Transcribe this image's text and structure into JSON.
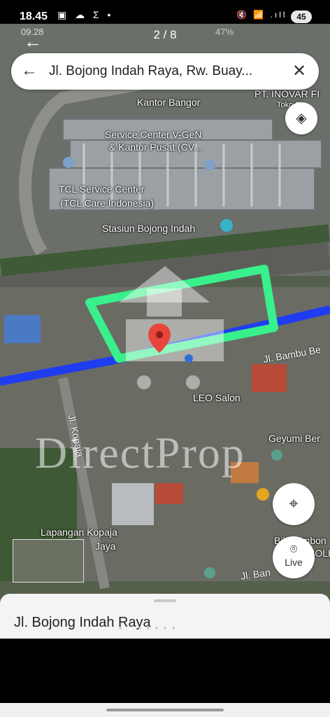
{
  "status": {
    "time": "18.45",
    "left_icons": "▣ ☁ Σ •",
    "right_icons": "🔇 📶 .ıll",
    "battery": "45"
  },
  "inner_status": {
    "time": "09.28",
    "right": "47%"
  },
  "gallery": {
    "counter": "2 / 8"
  },
  "search": {
    "query": "Jl. Bojong Indah Raya, Rw. Buay..."
  },
  "map_labels": {
    "kantor_bangor": "Kantor Bangor",
    "inovar": "PT. INOVAR FI",
    "toko": "Toko Pe",
    "service_center_1": "Service Center V-GeN",
    "service_center_2": "& Kantor Pusat (CV...",
    "tcl_1": "TCL Service Center",
    "tcl_2": "(TCL Care Indonesia)",
    "stasiun": "Stasiun Bojong Indah",
    "jl_bambu": "Jl. Bambu Be",
    "jl_kopaja": "Jl. Kopaja",
    "leo_salon": "LEO Salon",
    "geyumi": "Geyumi Ber",
    "lapangan": "Lapangan Kopaja",
    "jaya": "Jaya",
    "bika_1": "Bika Ambon",
    "bika_2": "Medan MOLEC",
    "jl_ban": "Jl. Ban",
    "watermark": "DirectProp"
  },
  "buttons": {
    "live": "Live"
  },
  "sheet": {
    "title": "Jl. Bojong Indah Raya"
  },
  "colors": {
    "highlight": "#39f08c",
    "road": "#1f3df0",
    "pin": "#e8453c"
  }
}
